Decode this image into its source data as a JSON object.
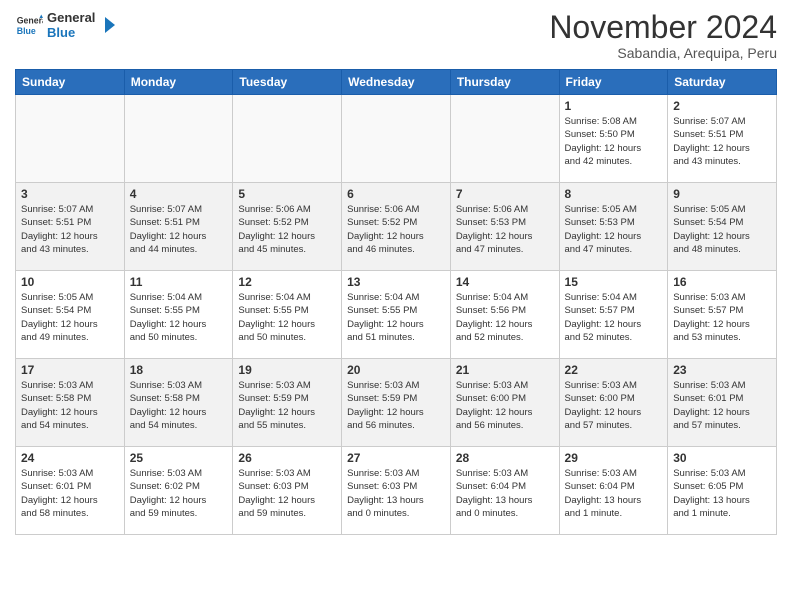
{
  "header": {
    "logo_general": "General",
    "logo_blue": "Blue",
    "title": "November 2024",
    "location": "Sabandia, Arequipa, Peru"
  },
  "weekdays": [
    "Sunday",
    "Monday",
    "Tuesday",
    "Wednesday",
    "Thursday",
    "Friday",
    "Saturday"
  ],
  "weeks": [
    [
      {
        "day": "",
        "info": ""
      },
      {
        "day": "",
        "info": ""
      },
      {
        "day": "",
        "info": ""
      },
      {
        "day": "",
        "info": ""
      },
      {
        "day": "",
        "info": ""
      },
      {
        "day": "1",
        "info": "Sunrise: 5:08 AM\nSunset: 5:50 PM\nDaylight: 12 hours\nand 42 minutes."
      },
      {
        "day": "2",
        "info": "Sunrise: 5:07 AM\nSunset: 5:51 PM\nDaylight: 12 hours\nand 43 minutes."
      }
    ],
    [
      {
        "day": "3",
        "info": "Sunrise: 5:07 AM\nSunset: 5:51 PM\nDaylight: 12 hours\nand 43 minutes."
      },
      {
        "day": "4",
        "info": "Sunrise: 5:07 AM\nSunset: 5:51 PM\nDaylight: 12 hours\nand 44 minutes."
      },
      {
        "day": "5",
        "info": "Sunrise: 5:06 AM\nSunset: 5:52 PM\nDaylight: 12 hours\nand 45 minutes."
      },
      {
        "day": "6",
        "info": "Sunrise: 5:06 AM\nSunset: 5:52 PM\nDaylight: 12 hours\nand 46 minutes."
      },
      {
        "day": "7",
        "info": "Sunrise: 5:06 AM\nSunset: 5:53 PM\nDaylight: 12 hours\nand 47 minutes."
      },
      {
        "day": "8",
        "info": "Sunrise: 5:05 AM\nSunset: 5:53 PM\nDaylight: 12 hours\nand 47 minutes."
      },
      {
        "day": "9",
        "info": "Sunrise: 5:05 AM\nSunset: 5:54 PM\nDaylight: 12 hours\nand 48 minutes."
      }
    ],
    [
      {
        "day": "10",
        "info": "Sunrise: 5:05 AM\nSunset: 5:54 PM\nDaylight: 12 hours\nand 49 minutes."
      },
      {
        "day": "11",
        "info": "Sunrise: 5:04 AM\nSunset: 5:55 PM\nDaylight: 12 hours\nand 50 minutes."
      },
      {
        "day": "12",
        "info": "Sunrise: 5:04 AM\nSunset: 5:55 PM\nDaylight: 12 hours\nand 50 minutes."
      },
      {
        "day": "13",
        "info": "Sunrise: 5:04 AM\nSunset: 5:55 PM\nDaylight: 12 hours\nand 51 minutes."
      },
      {
        "day": "14",
        "info": "Sunrise: 5:04 AM\nSunset: 5:56 PM\nDaylight: 12 hours\nand 52 minutes."
      },
      {
        "day": "15",
        "info": "Sunrise: 5:04 AM\nSunset: 5:57 PM\nDaylight: 12 hours\nand 52 minutes."
      },
      {
        "day": "16",
        "info": "Sunrise: 5:03 AM\nSunset: 5:57 PM\nDaylight: 12 hours\nand 53 minutes."
      }
    ],
    [
      {
        "day": "17",
        "info": "Sunrise: 5:03 AM\nSunset: 5:58 PM\nDaylight: 12 hours\nand 54 minutes."
      },
      {
        "day": "18",
        "info": "Sunrise: 5:03 AM\nSunset: 5:58 PM\nDaylight: 12 hours\nand 54 minutes."
      },
      {
        "day": "19",
        "info": "Sunrise: 5:03 AM\nSunset: 5:59 PM\nDaylight: 12 hours\nand 55 minutes."
      },
      {
        "day": "20",
        "info": "Sunrise: 5:03 AM\nSunset: 5:59 PM\nDaylight: 12 hours\nand 56 minutes."
      },
      {
        "day": "21",
        "info": "Sunrise: 5:03 AM\nSunset: 6:00 PM\nDaylight: 12 hours\nand 56 minutes."
      },
      {
        "day": "22",
        "info": "Sunrise: 5:03 AM\nSunset: 6:00 PM\nDaylight: 12 hours\nand 57 minutes."
      },
      {
        "day": "23",
        "info": "Sunrise: 5:03 AM\nSunset: 6:01 PM\nDaylight: 12 hours\nand 57 minutes."
      }
    ],
    [
      {
        "day": "24",
        "info": "Sunrise: 5:03 AM\nSunset: 6:01 PM\nDaylight: 12 hours\nand 58 minutes."
      },
      {
        "day": "25",
        "info": "Sunrise: 5:03 AM\nSunset: 6:02 PM\nDaylight: 12 hours\nand 59 minutes."
      },
      {
        "day": "26",
        "info": "Sunrise: 5:03 AM\nSunset: 6:03 PM\nDaylight: 12 hours\nand 59 minutes."
      },
      {
        "day": "27",
        "info": "Sunrise: 5:03 AM\nSunset: 6:03 PM\nDaylight: 13 hours\nand 0 minutes."
      },
      {
        "day": "28",
        "info": "Sunrise: 5:03 AM\nSunset: 6:04 PM\nDaylight: 13 hours\nand 0 minutes."
      },
      {
        "day": "29",
        "info": "Sunrise: 5:03 AM\nSunset: 6:04 PM\nDaylight: 13 hours\nand 1 minute."
      },
      {
        "day": "30",
        "info": "Sunrise: 5:03 AM\nSunset: 6:05 PM\nDaylight: 13 hours\nand 1 minute."
      }
    ]
  ]
}
